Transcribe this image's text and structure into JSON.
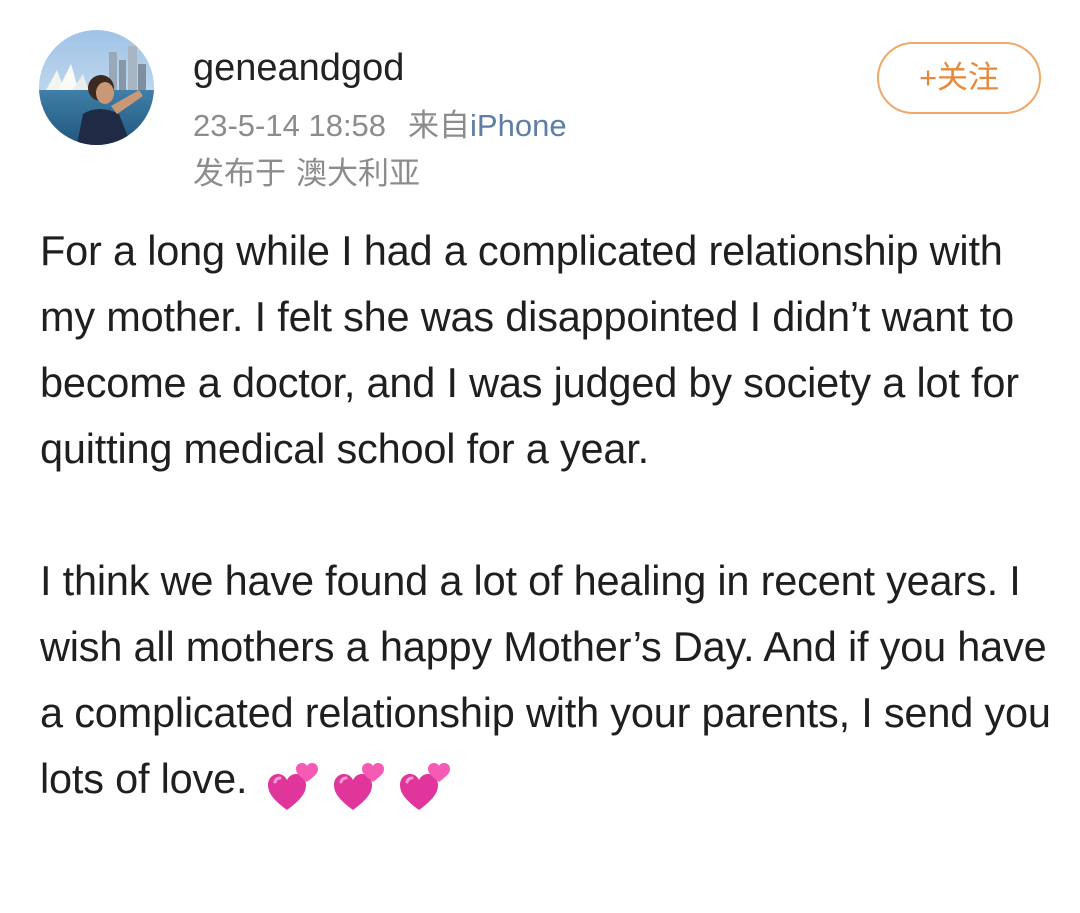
{
  "post": {
    "author": {
      "username": "geneandgod",
      "avatar": "avatar-photo"
    },
    "timestamp": "23-5-14 18:58",
    "source_prefix": "来自",
    "source_device": "iPhone",
    "location_prefix": "发布于",
    "location": "澳大利亚",
    "follow_label": "+关注",
    "body": {
      "paragraph_1": "For a long while I had a complicated relationship with my mother. I felt she was disappointed I didn’t want to become a doctor, and I was judged by society a lot for quitting medical school for a year.",
      "paragraph_2": "I think we have found a lot of healing in recent years. I wish all mothers a happy Mother’s Day. And if you have a complicated relationship with your parents, I send you lots of love.",
      "trailing_icons": [
        "two-hearts-icon",
        "two-hearts-icon",
        "two-hearts-icon"
      ]
    }
  },
  "colors": {
    "follow_accent": "#e8893a",
    "follow_border": "#f0a868",
    "link_blue": "#5d7ea6",
    "meta_gray": "#8c8c8c",
    "heart_pink": "#e0359a"
  }
}
